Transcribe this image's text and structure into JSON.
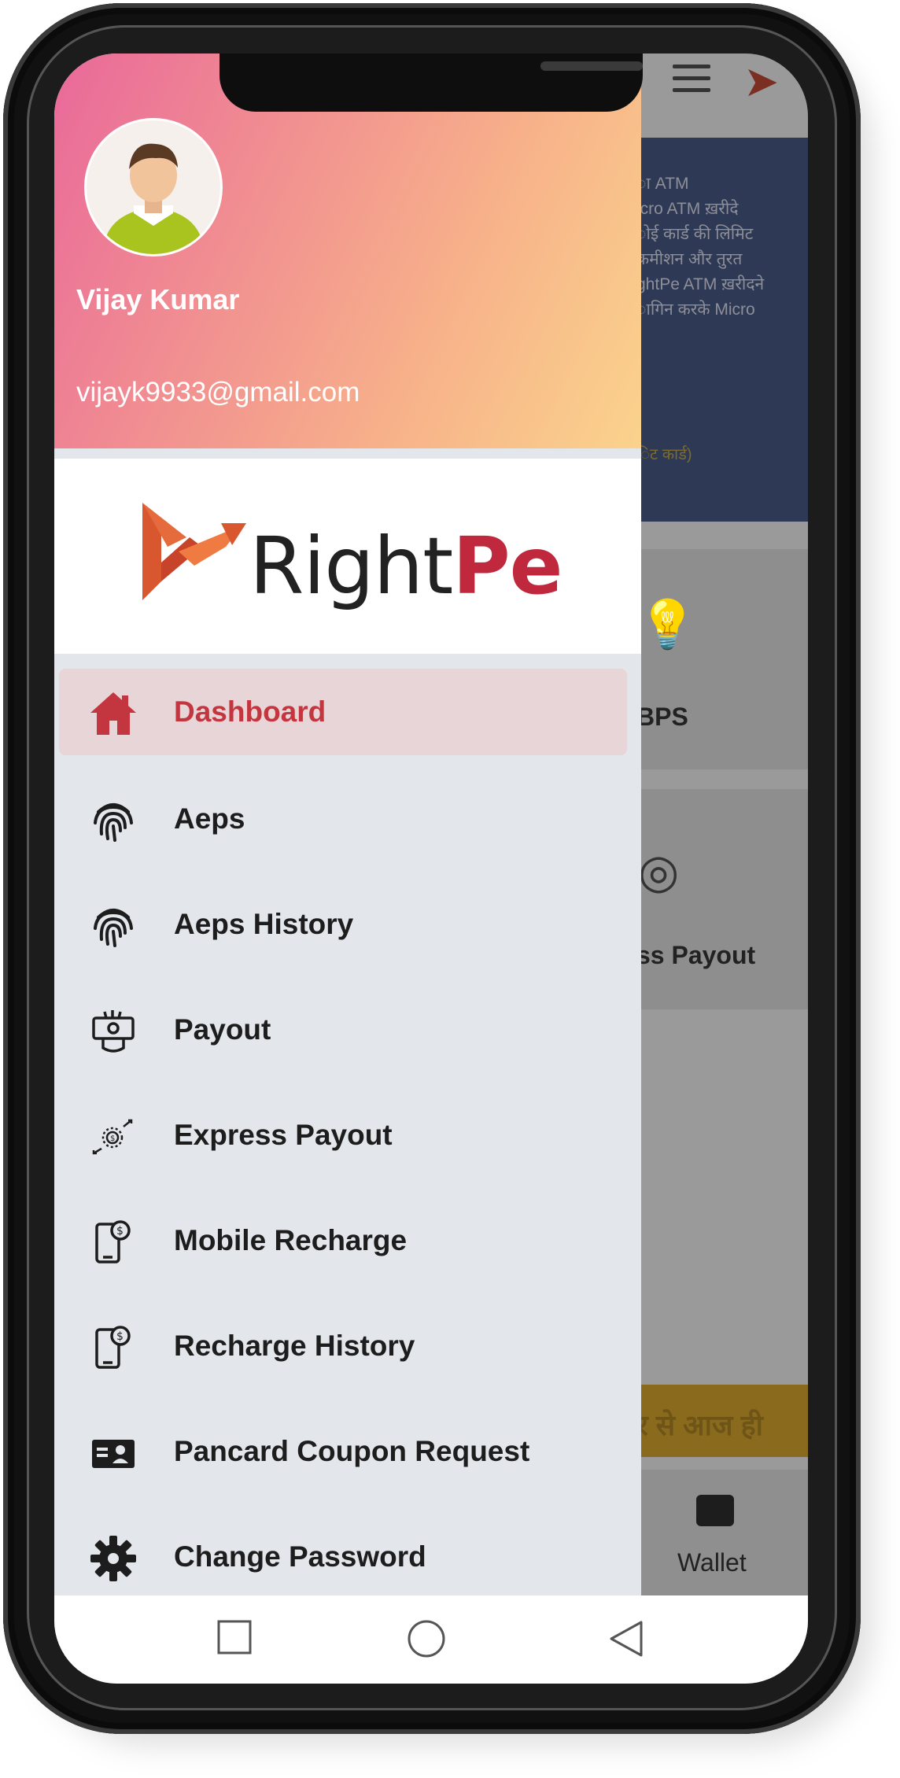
{
  "drawer": {
    "user_name": "Vijay Kumar",
    "user_email": "vijayk9933@gmail.com",
    "logo": {
      "text_right": "Right",
      "text_pe": "Pe"
    },
    "menu": [
      {
        "label": "Dashboard",
        "icon": "home-icon",
        "active": true
      },
      {
        "label": "Aeps",
        "icon": "fingerprint-icon",
        "active": false
      },
      {
        "label": "Aeps History",
        "icon": "fingerprint-icon",
        "active": false
      },
      {
        "label": "Payout",
        "icon": "money-hand-icon",
        "active": false
      },
      {
        "label": "Express Payout",
        "icon": "coin-transfer-icon",
        "active": false
      },
      {
        "label": "Mobile Recharge",
        "icon": "mobile-dollar-icon",
        "active": false
      },
      {
        "label": "Recharge History",
        "icon": "mobile-dollar-icon",
        "active": false
      },
      {
        "label": "Pancard Coupon Request",
        "icon": "id-card-icon",
        "active": false
      },
      {
        "label": "Change Password",
        "icon": "gear-icon",
        "active": false
      }
    ]
  },
  "background": {
    "banner_lines": [
      "ा ATM",
      "icro ATM ख़रीदे",
      "ोई कार्ड की लिमिट",
      "कमीशन और तुरत",
      "ghtPe ATM ख़रीदने",
      "ागिन करके Micro"
    ],
    "banner_note": "िट कार्ड)",
    "card1_label": "BPS",
    "card2_label": "ss Payout",
    "strip_text": "र से आज ही",
    "wallet_label": "Wallet"
  },
  "colors": {
    "active_accent": "#c3363f",
    "brand_red": "#c0283e",
    "active_bg": "#e8d5d7"
  }
}
